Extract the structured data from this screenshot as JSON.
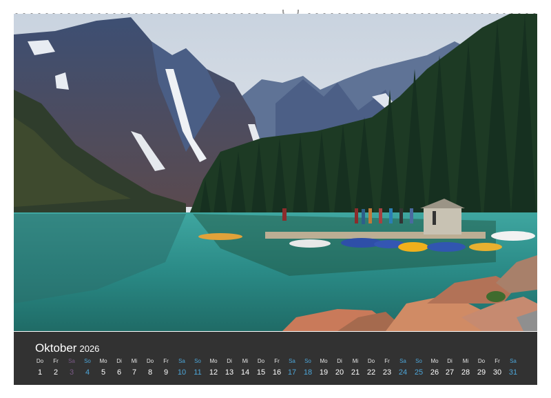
{
  "calendar": {
    "month": "Oktober",
    "year": "2026",
    "days": [
      {
        "dow": "Do",
        "num": "1",
        "type": "weekday"
      },
      {
        "dow": "Fr",
        "num": "2",
        "type": "weekday"
      },
      {
        "dow": "Sa",
        "num": "3",
        "type": "sun"
      },
      {
        "dow": "So",
        "num": "4",
        "type": "sat"
      },
      {
        "dow": "Mo",
        "num": "5",
        "type": "weekday"
      },
      {
        "dow": "Di",
        "num": "6",
        "type": "weekday"
      },
      {
        "dow": "Mi",
        "num": "7",
        "type": "weekday"
      },
      {
        "dow": "Do",
        "num": "8",
        "type": "weekday"
      },
      {
        "dow": "Fr",
        "num": "9",
        "type": "weekday"
      },
      {
        "dow": "Sa",
        "num": "10",
        "type": "sat"
      },
      {
        "dow": "So",
        "num": "11",
        "type": "sat"
      },
      {
        "dow": "Mo",
        "num": "12",
        "type": "weekday"
      },
      {
        "dow": "Di",
        "num": "13",
        "type": "weekday"
      },
      {
        "dow": "Mi",
        "num": "14",
        "type": "weekday"
      },
      {
        "dow": "Do",
        "num": "15",
        "type": "weekday"
      },
      {
        "dow": "Fr",
        "num": "16",
        "type": "weekday"
      },
      {
        "dow": "Sa",
        "num": "17",
        "type": "sat"
      },
      {
        "dow": "So",
        "num": "18",
        "type": "sat"
      },
      {
        "dow": "Mo",
        "num": "19",
        "type": "weekday"
      },
      {
        "dow": "Di",
        "num": "20",
        "type": "weekday"
      },
      {
        "dow": "Mi",
        "num": "21",
        "type": "weekday"
      },
      {
        "dow": "Do",
        "num": "22",
        "type": "weekday"
      },
      {
        "dow": "Fr",
        "num": "23",
        "type": "weekday"
      },
      {
        "dow": "Sa",
        "num": "24",
        "type": "sat"
      },
      {
        "dow": "So",
        "num": "25",
        "type": "sat"
      },
      {
        "dow": "Mo",
        "num": "26",
        "type": "weekday"
      },
      {
        "dow": "Di",
        "num": "27",
        "type": "weekday"
      },
      {
        "dow": "Mi",
        "num": "28",
        "type": "weekday"
      },
      {
        "dow": "Do",
        "num": "29",
        "type": "weekday"
      },
      {
        "dow": "Fr",
        "num": "30",
        "type": "weekday"
      },
      {
        "dow": "Sa",
        "num": "31",
        "type": "sat"
      }
    ]
  },
  "colors": {
    "calendar_bg": "#323232",
    "saturday": "#4da6d9",
    "sunday_muted": "#7a5a86",
    "lake": "#2f8f8a"
  }
}
